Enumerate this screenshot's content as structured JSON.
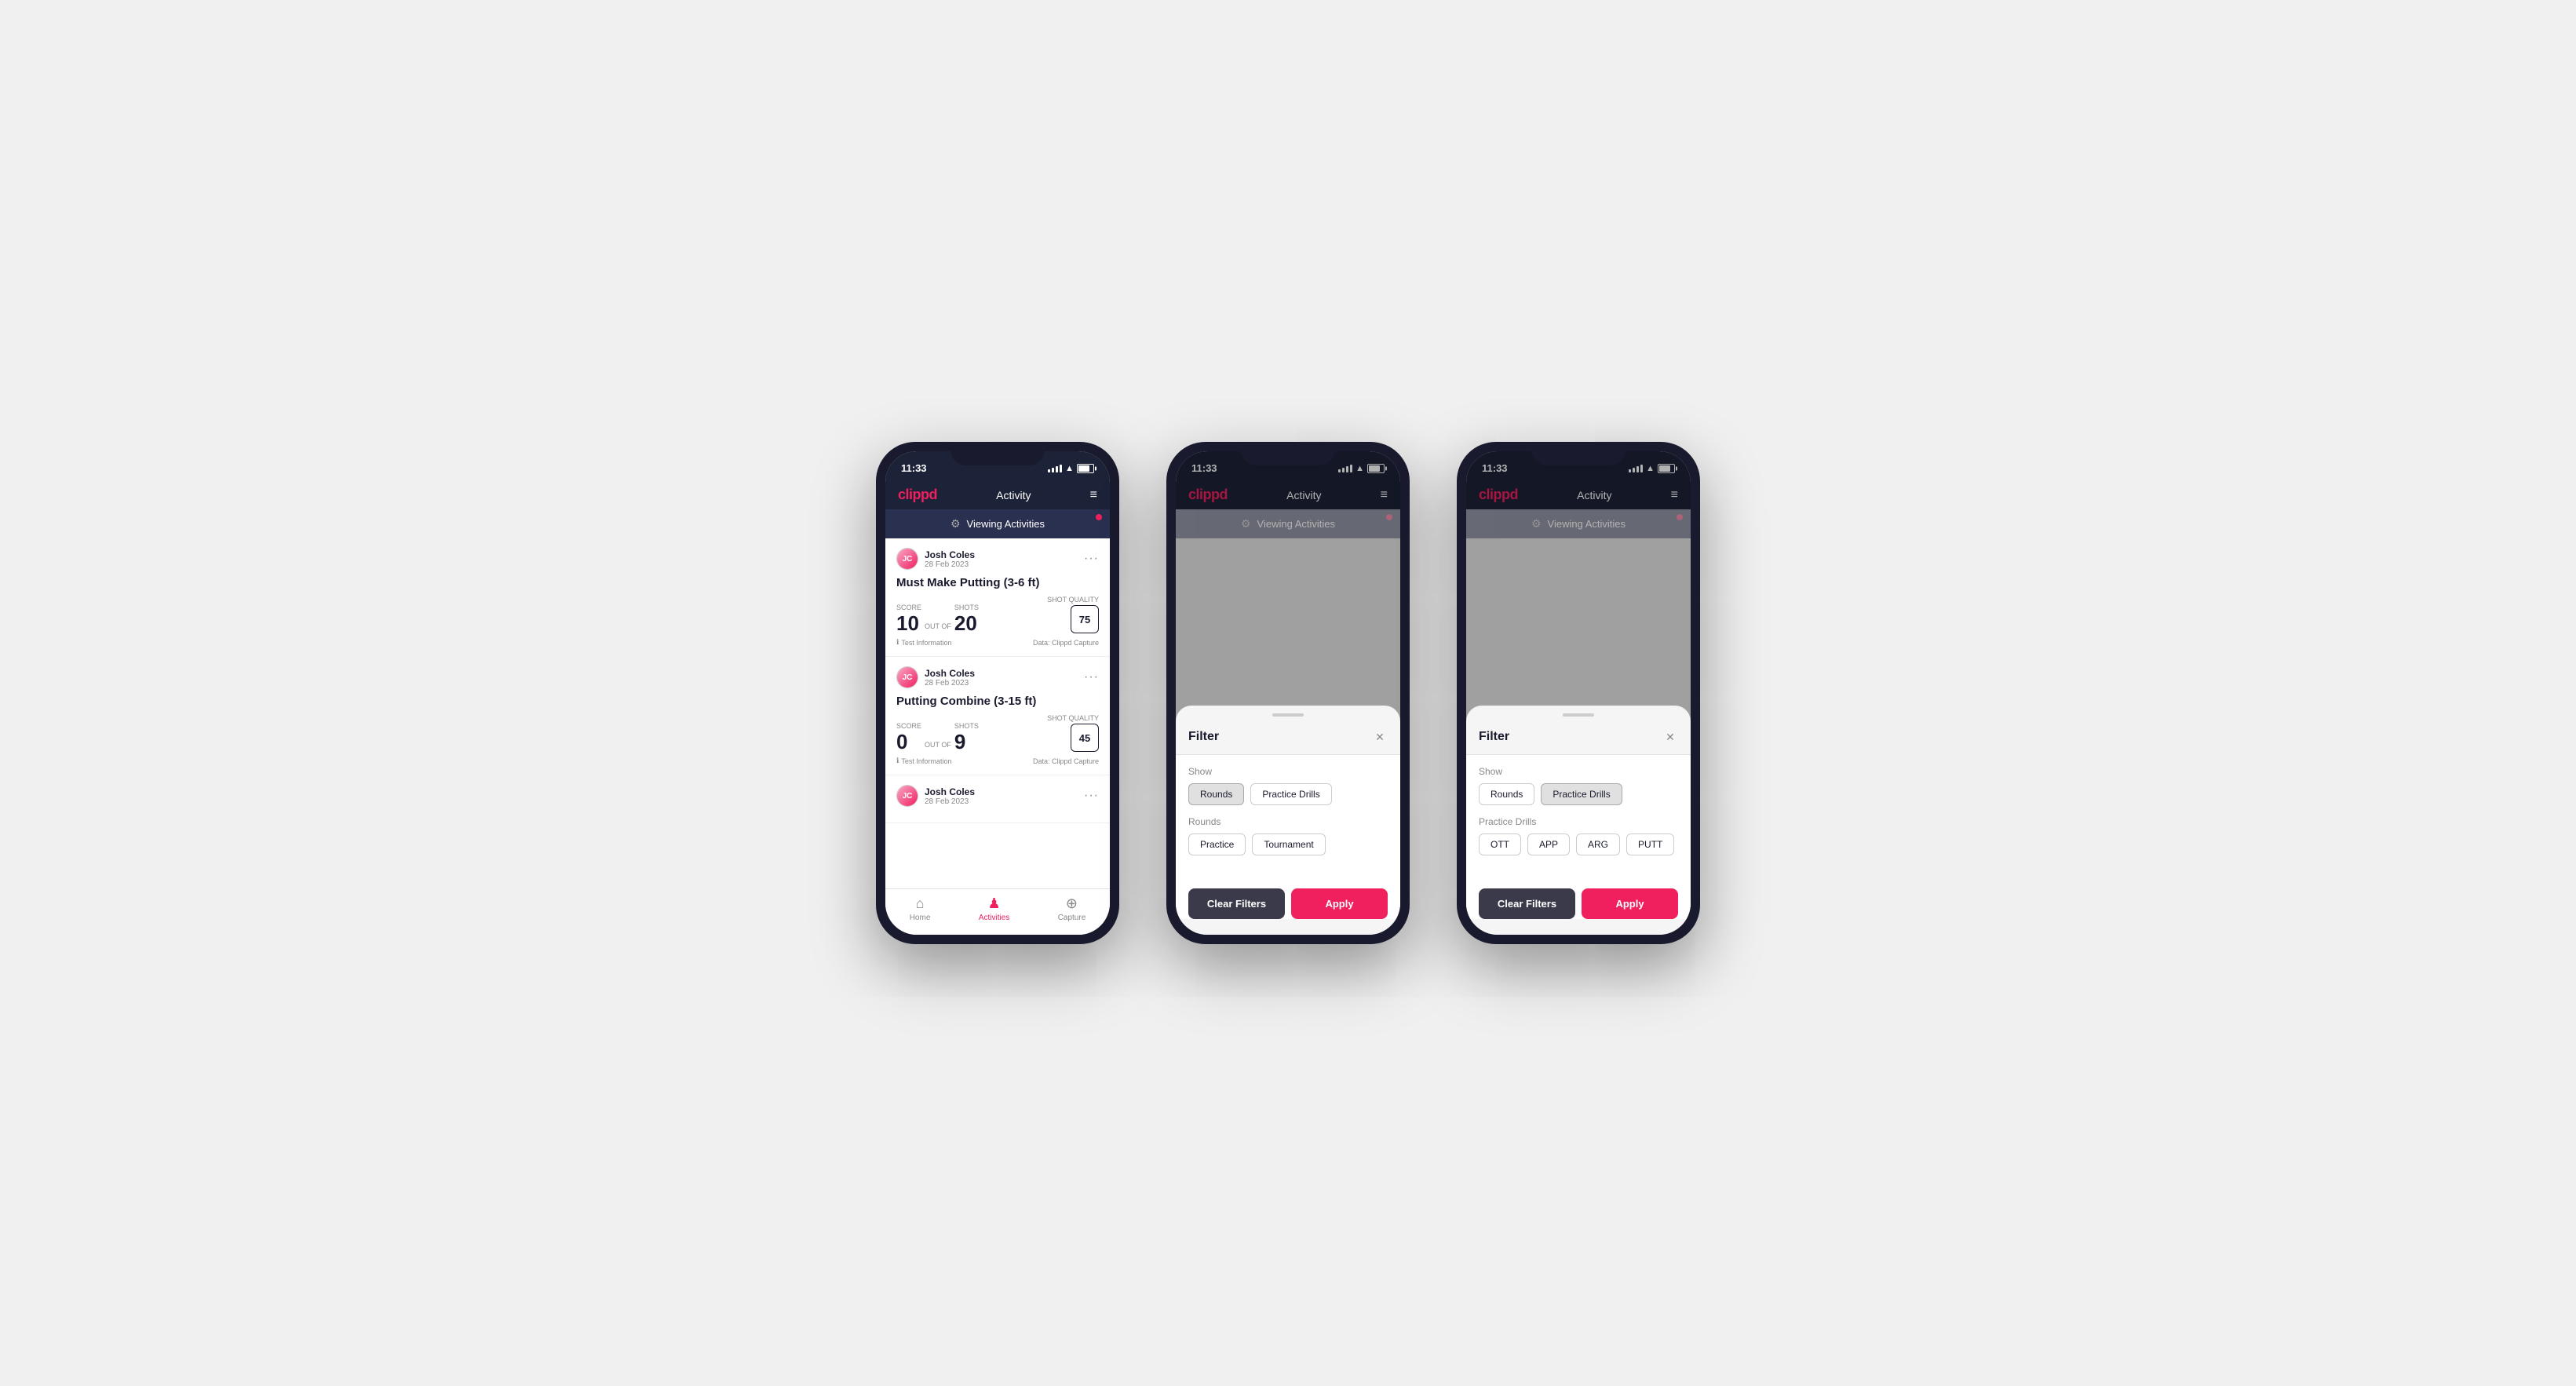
{
  "colors": {
    "brand": "#f01f5e",
    "dark_bg": "#1c2237",
    "card_bg": "#fff",
    "text_primary": "#1a1a2e",
    "text_secondary": "#888"
  },
  "phones": [
    {
      "id": "phone1",
      "status_time": "11:33",
      "battery": "81",
      "header": {
        "logo": "clippd",
        "title": "Activity",
        "menu_label": "≡"
      },
      "viewing_bar": "Viewing Activities",
      "activities": [
        {
          "user_name": "Josh Coles",
          "user_date": "28 Feb 2023",
          "title": "Must Make Putting (3-6 ft)",
          "score_label": "Score",
          "score_value": "10",
          "out_of": "OUT OF",
          "shots_label": "Shots",
          "shots_value": "20",
          "shot_quality_label": "Shot Quality",
          "shot_quality_value": "75",
          "test_info": "Test Information",
          "data_source": "Data: Clippd Capture"
        },
        {
          "user_name": "Josh Coles",
          "user_date": "28 Feb 2023",
          "title": "Putting Combine (3-15 ft)",
          "score_label": "Score",
          "score_value": "0",
          "out_of": "OUT OF",
          "shots_label": "Shots",
          "shots_value": "9",
          "shot_quality_label": "Shot Quality",
          "shot_quality_value": "45",
          "test_info": "Test Information",
          "data_source": "Data: Clippd Capture"
        },
        {
          "user_name": "Josh Coles",
          "user_date": "28 Feb 2023"
        }
      ],
      "nav": {
        "items": [
          {
            "icon": "🏠",
            "label": "Home",
            "active": false
          },
          {
            "icon": "📋",
            "label": "Activities",
            "active": true
          },
          {
            "icon": "➕",
            "label": "Capture",
            "active": false
          }
        ]
      },
      "show_filter": false
    },
    {
      "id": "phone2",
      "status_time": "11:33",
      "battery": "81",
      "header": {
        "logo": "clippd",
        "title": "Activity",
        "menu_label": "≡"
      },
      "viewing_bar": "Viewing Activities",
      "show_filter": true,
      "filter": {
        "title": "Filter",
        "show_label": "Show",
        "show_chips": [
          {
            "label": "Rounds",
            "active": true
          },
          {
            "label": "Practice Drills",
            "active": false
          }
        ],
        "rounds_label": "Rounds",
        "rounds_chips": [
          {
            "label": "Practice",
            "active": false
          },
          {
            "label": "Tournament",
            "active": false
          }
        ],
        "has_drills": false,
        "clear_label": "Clear Filters",
        "apply_label": "Apply"
      }
    },
    {
      "id": "phone3",
      "status_time": "11:33",
      "battery": "81",
      "header": {
        "logo": "clippd",
        "title": "Activity",
        "menu_label": "≡"
      },
      "viewing_bar": "Viewing Activities",
      "show_filter": true,
      "filter": {
        "title": "Filter",
        "show_label": "Show",
        "show_chips": [
          {
            "label": "Rounds",
            "active": false
          },
          {
            "label": "Practice Drills",
            "active": true
          }
        ],
        "drills_label": "Practice Drills",
        "drills_chips": [
          {
            "label": "OTT",
            "active": false
          },
          {
            "label": "APP",
            "active": false
          },
          {
            "label": "ARG",
            "active": false
          },
          {
            "label": "PUTT",
            "active": false
          }
        ],
        "has_drills": true,
        "clear_label": "Clear Filters",
        "apply_label": "Apply"
      }
    }
  ]
}
